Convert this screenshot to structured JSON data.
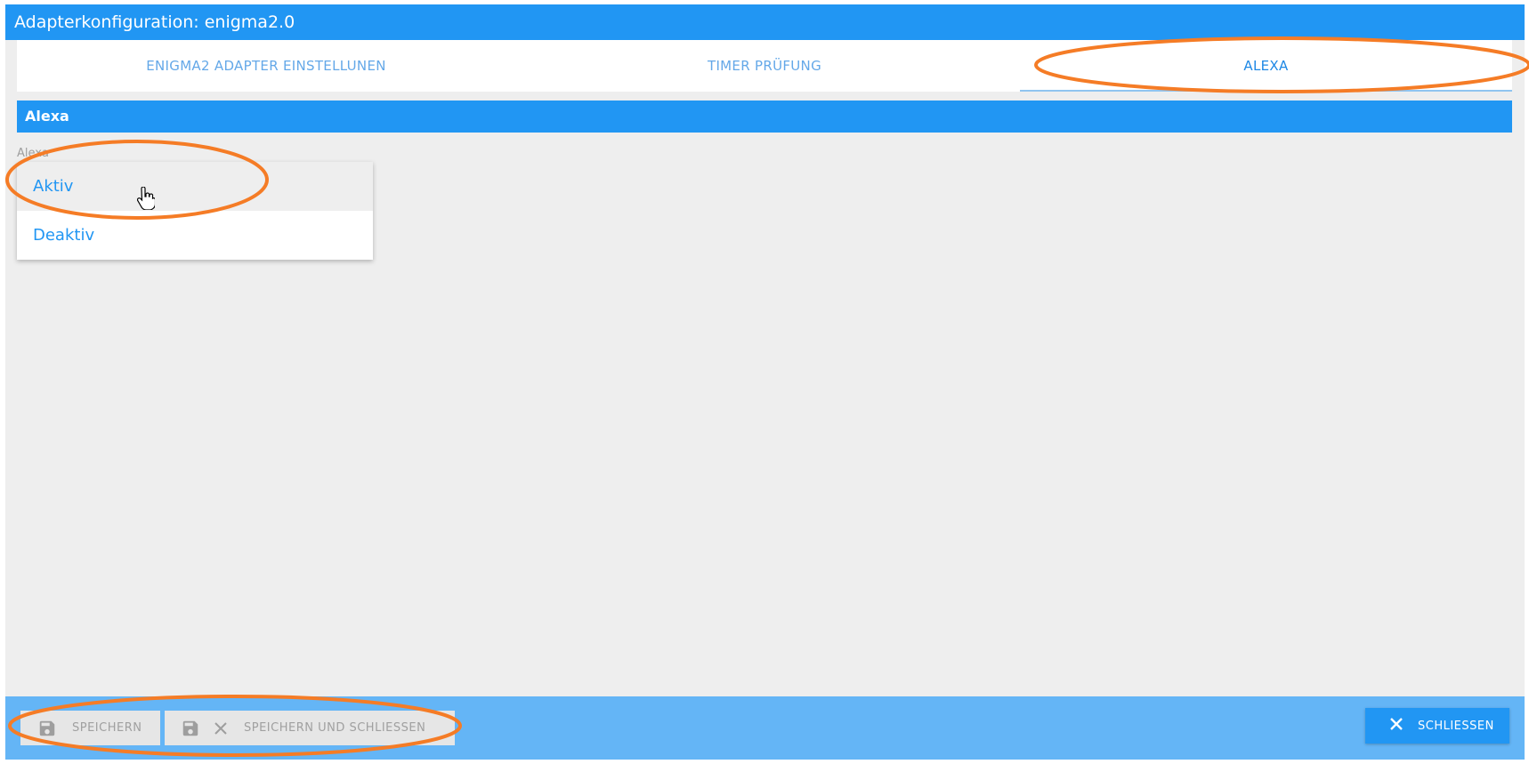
{
  "window": {
    "title": "Adapterkonfiguration: enigma2.0"
  },
  "tabs": [
    {
      "label": "ENIGMA2 ADAPTER EINSTELLUNEN"
    },
    {
      "label": "TIMER PRÜFUNG"
    },
    {
      "label": "ALEXA",
      "active": true
    }
  ],
  "section": {
    "title": "Alexa"
  },
  "alexa_select": {
    "label": "Alexa",
    "options": [
      {
        "label": "Aktiv",
        "hovered": true
      },
      {
        "label": "Deaktiv"
      }
    ]
  },
  "footer": {
    "save_label": "SPEICHERN",
    "save_close_label": "SPEICHERN UND SCHLIESSEN",
    "close_label": "SCHLIESSEN"
  },
  "icons": {
    "save": "floppy-disk-icon",
    "close": "close-x-icon",
    "cursor": "hand-pointer-icon"
  },
  "colors": {
    "primary": "#2196f3",
    "footer_bg": "#64b5f6",
    "annotation": "#f57c26",
    "page_bg": "#eeeeee"
  }
}
